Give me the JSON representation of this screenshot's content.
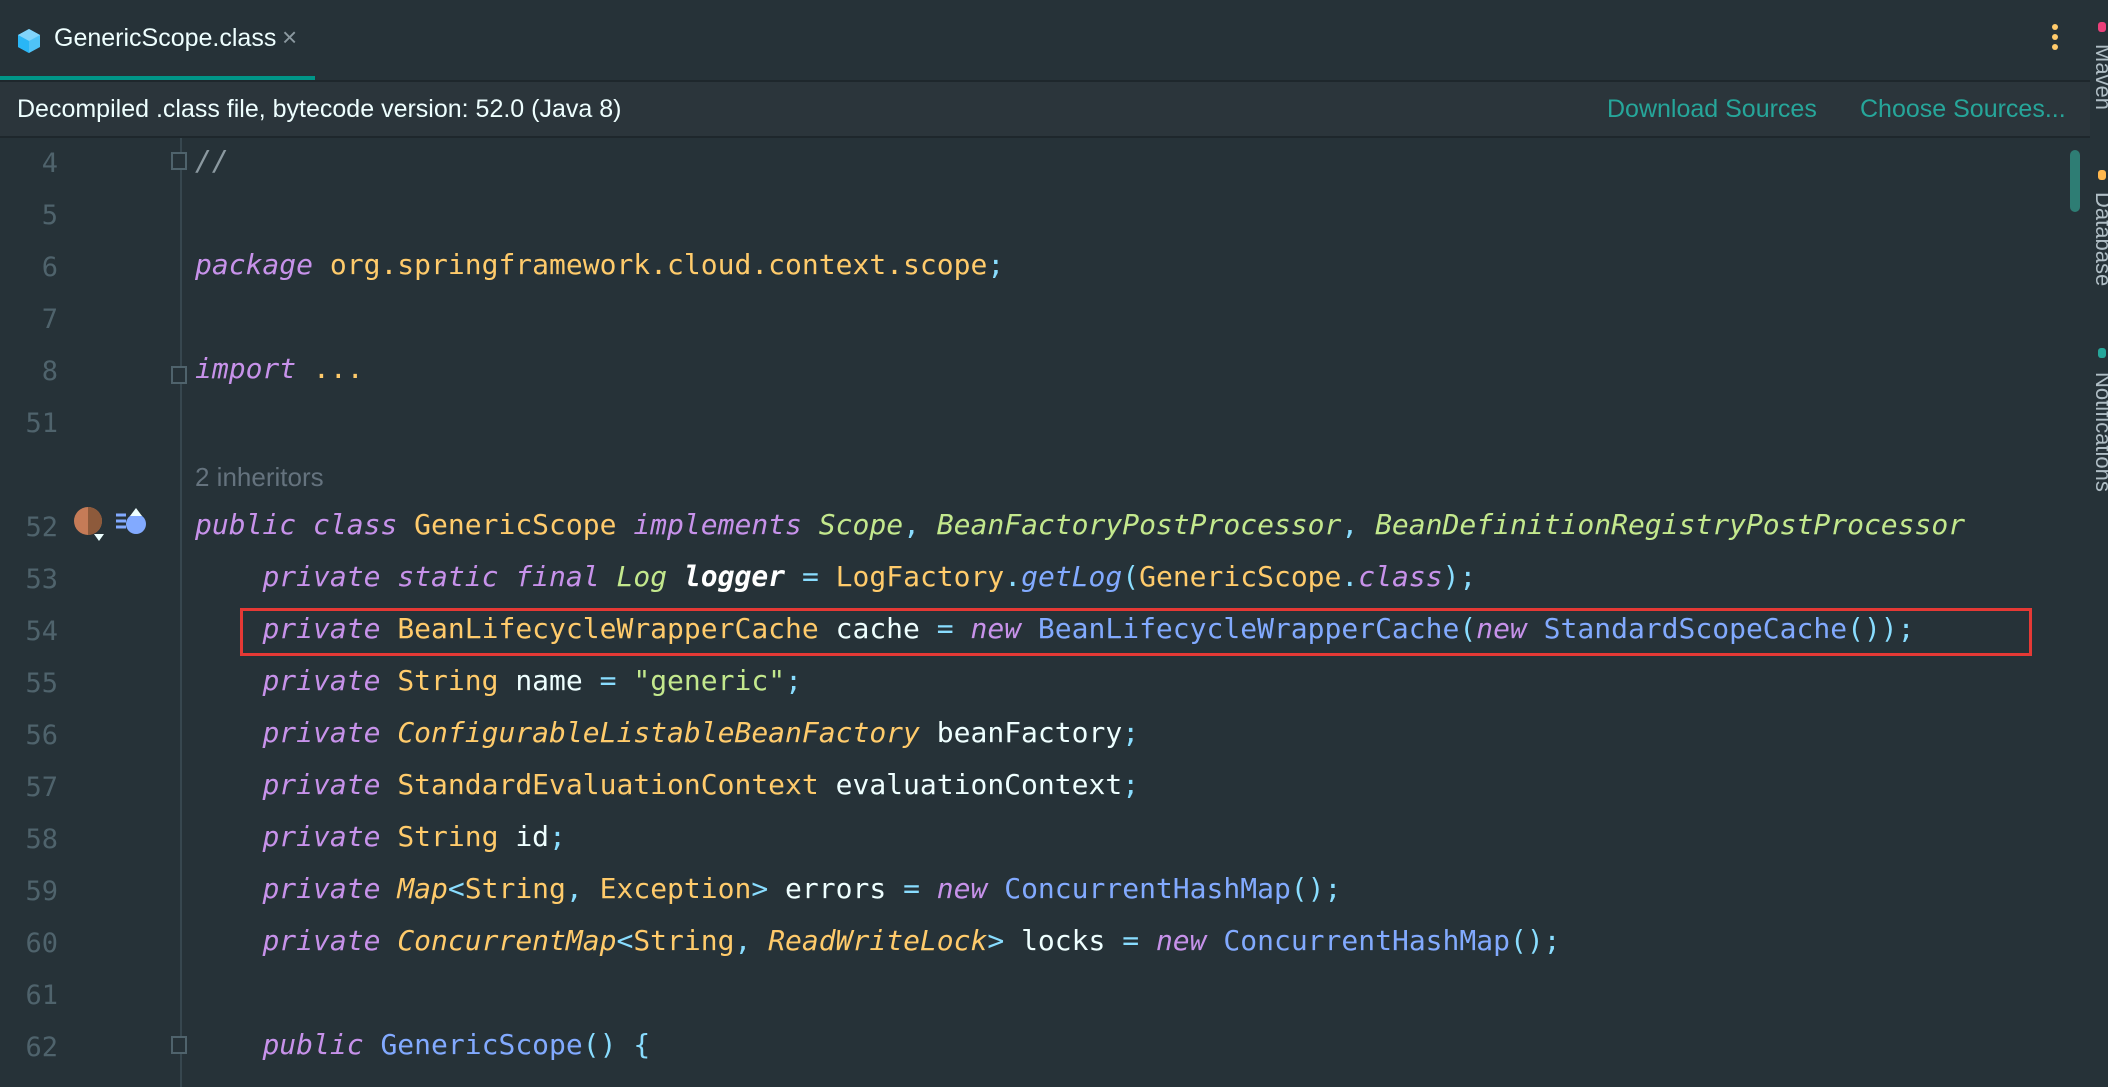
{
  "tab": {
    "label": "GenericScope.class",
    "close": "×",
    "icon": "class-file-icon"
  },
  "right_panels": [
    {
      "label": "Maven",
      "color": "#ec407a"
    },
    {
      "label": "Database",
      "color": "#ffb74d"
    },
    {
      "label": "Notifications",
      "color": "#26a69a"
    }
  ],
  "banner": {
    "text": "Decompiled .class file, bytecode version: 52.0 (Java 8)",
    "download_sources": "Download Sources",
    "choose_sources": "Choose Sources..."
  },
  "editor": {
    "inherits_hint": "2 inheritors",
    "lines": [
      {
        "no": "4",
        "segments": [
          [
            "com",
            "//"
          ]
        ]
      },
      {
        "no": "5",
        "segments": []
      },
      {
        "no": "6",
        "segments": [
          [
            "kw",
            "package"
          ],
          [
            "id",
            " "
          ],
          [
            "ty",
            "org.springframework.cloud.context.scope"
          ],
          [
            "pu",
            ";"
          ]
        ]
      },
      {
        "no": "7",
        "segments": []
      },
      {
        "no": "8",
        "segments": [
          [
            "kw",
            "import"
          ],
          [
            "id",
            " "
          ],
          [
            "ty",
            "..."
          ]
        ]
      },
      {
        "no": "51",
        "segments": []
      },
      {
        "no": "",
        "segments": []
      },
      {
        "no": "52",
        "segments": [
          [
            "kw",
            "public"
          ],
          [
            "id",
            " "
          ],
          [
            "kw",
            "class"
          ],
          [
            "id",
            " "
          ],
          [
            "ty",
            "GenericScope"
          ],
          [
            "id",
            " "
          ],
          [
            "kw",
            "implements"
          ],
          [
            "id",
            " "
          ],
          [
            "tyi",
            "Scope"
          ],
          [
            "pu",
            ", "
          ],
          [
            "tyi",
            "BeanFactoryPostProcessor"
          ],
          [
            "pu",
            ", "
          ],
          [
            "tyi",
            "BeanDefinitionRegistryPostProcessor"
          ]
        ]
      },
      {
        "no": "53",
        "segments": [
          [
            "id",
            "    "
          ],
          [
            "kw",
            "private"
          ],
          [
            "id",
            " "
          ],
          [
            "kw",
            "static"
          ],
          [
            "id",
            " "
          ],
          [
            "kw",
            "final"
          ],
          [
            "id",
            " "
          ],
          [
            "tyi",
            "Log"
          ],
          [
            "id",
            " "
          ],
          [
            "bold",
            "logger"
          ],
          [
            "id",
            " "
          ],
          [
            "pu",
            "="
          ],
          [
            "id",
            " "
          ],
          [
            "ty",
            "LogFactory"
          ],
          [
            "pu",
            "."
          ],
          [
            "fn",
            "getLog"
          ],
          [
            "pu",
            "("
          ],
          [
            "ty",
            "GenericScope"
          ],
          [
            "pu",
            "."
          ],
          [
            "kw",
            "class"
          ],
          [
            "pu",
            ");"
          ]
        ]
      },
      {
        "no": "54",
        "segments": [
          [
            "id",
            "    "
          ],
          [
            "kw",
            "private"
          ],
          [
            "id",
            " "
          ],
          [
            "ty",
            "BeanLifecycleWrapperCache"
          ],
          [
            "id",
            " cache "
          ],
          [
            "pu",
            "="
          ],
          [
            "id",
            " "
          ],
          [
            "kw",
            "new"
          ],
          [
            "id",
            " "
          ],
          [
            "cl",
            "BeanLifecycleWrapperCache"
          ],
          [
            "pu",
            "("
          ],
          [
            "kw",
            "new"
          ],
          [
            "id",
            " "
          ],
          [
            "cl",
            "StandardScopeCache"
          ],
          [
            "pu",
            "());"
          ]
        ]
      },
      {
        "no": "55",
        "segments": [
          [
            "id",
            "    "
          ],
          [
            "kw",
            "private"
          ],
          [
            "id",
            " "
          ],
          [
            "ty",
            "String"
          ],
          [
            "id",
            " name "
          ],
          [
            "pu",
            "="
          ],
          [
            "id",
            " "
          ],
          [
            "str",
            "\"generic\""
          ],
          [
            "pu",
            ";"
          ]
        ]
      },
      {
        "no": "56",
        "segments": [
          [
            "id",
            "    "
          ],
          [
            "kw",
            "private"
          ],
          [
            "id",
            " "
          ],
          [
            "tyi2",
            "ConfigurableListableBeanFactory"
          ],
          [
            "id",
            " beanFactory"
          ],
          [
            "pu",
            ";"
          ]
        ]
      },
      {
        "no": "57",
        "segments": [
          [
            "id",
            "    "
          ],
          [
            "kw",
            "private"
          ],
          [
            "id",
            " "
          ],
          [
            "ty",
            "StandardEvaluationContext"
          ],
          [
            "id",
            " evaluationContext"
          ],
          [
            "pu",
            ";"
          ]
        ]
      },
      {
        "no": "58",
        "segments": [
          [
            "id",
            "    "
          ],
          [
            "kw",
            "private"
          ],
          [
            "id",
            " "
          ],
          [
            "ty",
            "String"
          ],
          [
            "id",
            " id"
          ],
          [
            "pu",
            ";"
          ]
        ]
      },
      {
        "no": "59",
        "segments": [
          [
            "id",
            "    "
          ],
          [
            "kw",
            "private"
          ],
          [
            "id",
            " "
          ],
          [
            "tyi2",
            "Map"
          ],
          [
            "pu",
            "<"
          ],
          [
            "ty",
            "String"
          ],
          [
            "pu",
            ", "
          ],
          [
            "ty",
            "Exception"
          ],
          [
            "pu",
            ">"
          ],
          [
            "id",
            " errors "
          ],
          [
            "pu",
            "="
          ],
          [
            "id",
            " "
          ],
          [
            "kw",
            "new"
          ],
          [
            "id",
            " "
          ],
          [
            "cl",
            "ConcurrentHashMap"
          ],
          [
            "pu",
            "();"
          ]
        ]
      },
      {
        "no": "60",
        "segments": [
          [
            "id",
            "    "
          ],
          [
            "kw",
            "private"
          ],
          [
            "id",
            " "
          ],
          [
            "tyi2",
            "ConcurrentMap"
          ],
          [
            "pu",
            "<"
          ],
          [
            "ty",
            "String"
          ],
          [
            "pu",
            ", "
          ],
          [
            "tyi2",
            "ReadWriteLock"
          ],
          [
            "pu",
            ">"
          ],
          [
            "id",
            " locks "
          ],
          [
            "pu",
            "="
          ],
          [
            "id",
            " "
          ],
          [
            "kw",
            "new"
          ],
          [
            "id",
            " "
          ],
          [
            "cl",
            "ConcurrentHashMap"
          ],
          [
            "pu",
            "();"
          ]
        ]
      },
      {
        "no": "61",
        "segments": []
      },
      {
        "no": "62",
        "segments": [
          [
            "id",
            "    "
          ],
          [
            "kw",
            "public"
          ],
          [
            "id",
            " "
          ],
          [
            "cl",
            "GenericScope"
          ],
          [
            "pu",
            "() {"
          ]
        ]
      }
    ]
  },
  "colors": {
    "background": "#263238",
    "accent": "#009688",
    "link": "#26a69a",
    "highlight_border": "#e53935"
  }
}
